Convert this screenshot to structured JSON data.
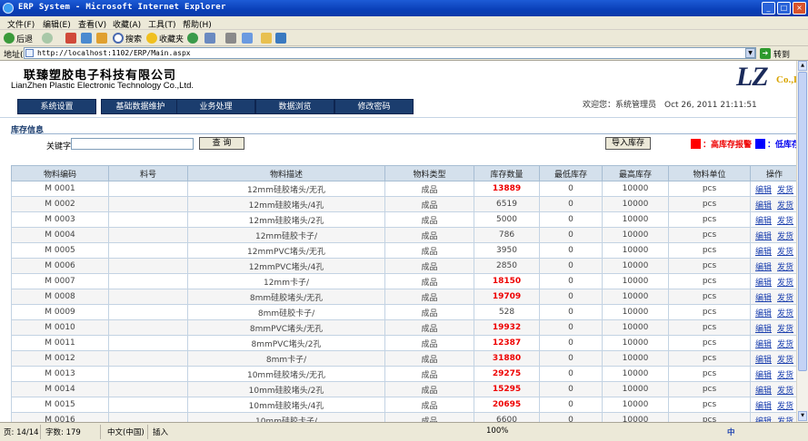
{
  "window": {
    "title": "ERP System - Microsoft Internet Explorer",
    "controls": {
      "minimize": "_",
      "maximize": "□",
      "close": "×"
    }
  },
  "menubar": [
    "文件(F)",
    "编辑(E)",
    "查看(V)",
    "收藏(A)",
    "工具(T)",
    "帮助(H)"
  ],
  "toolbar": {
    "back": "后退",
    "search": "搜索",
    "favorites": "收藏夹"
  },
  "addressbar": {
    "label": "地址(D)",
    "url": "http://localhost:1102/ERP/Main.aspx",
    "go": "转到"
  },
  "header": {
    "company_cn": "联臻塑胶电子科技有限公司",
    "company_en": "LianZhen Plastic Electronic Technology Co.,Ltd.",
    "logo_text": "LZ",
    "logo_suffix": "Co.,L",
    "welcome": "欢迎您：系统管理员　Oct 26, 2011 21:11:51"
  },
  "nav": [
    "系统设置",
    "基础数据维护",
    "业务处理",
    "数据浏览",
    "修改密码"
  ],
  "section": {
    "title": "库存信息",
    "keyword_label": "关键字",
    "keyword_value": "",
    "search_button": "查 询",
    "import_button": "导入库存",
    "legend_high": "：高库存报警",
    "legend_low": "：低库存报"
  },
  "colors": {
    "high_alarm": "#ff0000",
    "low_alarm": "#0000ff",
    "nav_bg": "#1b3d6e"
  },
  "table": {
    "columns": [
      "物料编码",
      "料号",
      "物料描述",
      "物料类型",
      "库存数量",
      "最低库存",
      "最高库存",
      "物料单位",
      "操作"
    ],
    "action_edit": "编辑",
    "action_ship": "发货",
    "rows": [
      {
        "code": "M 0001",
        "part": "",
        "desc": "12mm硅胶堵头/无孔",
        "type": "成品",
        "qty": "13889",
        "min": "0",
        "max": "10000",
        "unit": "pcs",
        "alarm": true
      },
      {
        "code": "M 0002",
        "part": "",
        "desc": "12mm硅胶堵头/4孔",
        "type": "成品",
        "qty": "6519",
        "min": "0",
        "max": "10000",
        "unit": "pcs",
        "alarm": false
      },
      {
        "code": "M 0003",
        "part": "",
        "desc": "12mm硅胶堵头/2孔",
        "type": "成品",
        "qty": "5000",
        "min": "0",
        "max": "10000",
        "unit": "pcs",
        "alarm": false
      },
      {
        "code": "M 0004",
        "part": "",
        "desc": "12mm硅胶卡子/",
        "type": "成品",
        "qty": "786",
        "min": "0",
        "max": "10000",
        "unit": "pcs",
        "alarm": false
      },
      {
        "code": "M 0005",
        "part": "",
        "desc": "12mmPVC堵头/无孔",
        "type": "成品",
        "qty": "3950",
        "min": "0",
        "max": "10000",
        "unit": "pcs",
        "alarm": false
      },
      {
        "code": "M 0006",
        "part": "",
        "desc": "12mmPVC堵头/4孔",
        "type": "成品",
        "qty": "2850",
        "min": "0",
        "max": "10000",
        "unit": "pcs",
        "alarm": false
      },
      {
        "code": "M 0007",
        "part": "",
        "desc": "12mm卡子/",
        "type": "成品",
        "qty": "18150",
        "min": "0",
        "max": "10000",
        "unit": "pcs",
        "alarm": true
      },
      {
        "code": "M 0008",
        "part": "",
        "desc": "8mm硅胶堵头/无孔",
        "type": "成品",
        "qty": "19709",
        "min": "0",
        "max": "10000",
        "unit": "pcs",
        "alarm": true
      },
      {
        "code": "M 0009",
        "part": "",
        "desc": "8mm硅胶卡子/",
        "type": "成品",
        "qty": "528",
        "min": "0",
        "max": "10000",
        "unit": "pcs",
        "alarm": false
      },
      {
        "code": "M 0010",
        "part": "",
        "desc": "8mmPVC堵头/无孔",
        "type": "成品",
        "qty": "19932",
        "min": "0",
        "max": "10000",
        "unit": "pcs",
        "alarm": true
      },
      {
        "code": "M 0011",
        "part": "",
        "desc": "8mmPVC堵头/2孔",
        "type": "成品",
        "qty": "12387",
        "min": "0",
        "max": "10000",
        "unit": "pcs",
        "alarm": true
      },
      {
        "code": "M 0012",
        "part": "",
        "desc": "8mm卡子/",
        "type": "成品",
        "qty": "31880",
        "min": "0",
        "max": "10000",
        "unit": "pcs",
        "alarm": true
      },
      {
        "code": "M 0013",
        "part": "",
        "desc": "10mm硅胶堵头/无孔",
        "type": "成品",
        "qty": "29275",
        "min": "0",
        "max": "10000",
        "unit": "pcs",
        "alarm": true
      },
      {
        "code": "M 0014",
        "part": "",
        "desc": "10mm硅胶堵头/2孔",
        "type": "成品",
        "qty": "15295",
        "min": "0",
        "max": "10000",
        "unit": "pcs",
        "alarm": true
      },
      {
        "code": "M 0015",
        "part": "",
        "desc": "10mm硅胶堵头/4孔",
        "type": "成品",
        "qty": "20695",
        "min": "0",
        "max": "10000",
        "unit": "pcs",
        "alarm": true
      },
      {
        "code": "M 0016",
        "part": "",
        "desc": "10mm硅胶卡子/",
        "type": "成品",
        "qty": "6600",
        "min": "0",
        "max": "10000",
        "unit": "pcs",
        "alarm": false
      }
    ]
  },
  "statusbar": {
    "page": "页: 14/14",
    "chars": "字数: 179",
    "language": "中文(中国)",
    "mode": "插入",
    "zoom": "100%",
    "ime": "中"
  }
}
